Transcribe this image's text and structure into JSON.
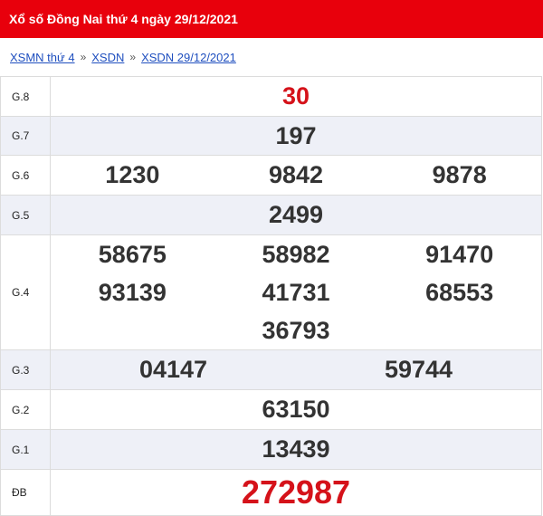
{
  "header": {
    "title": "Xổ số Đồng Nai thứ 4 ngày 29/12/2021"
  },
  "breadcrumb": {
    "items": [
      "XSMN thứ 4",
      "XSDN",
      "XSDN 29/12/2021"
    ],
    "separator": "»"
  },
  "results": {
    "g8": {
      "label": "G.8",
      "numbers": [
        "30"
      ]
    },
    "g7": {
      "label": "G.7",
      "numbers": [
        "197"
      ]
    },
    "g6": {
      "label": "G.6",
      "numbers": [
        "1230",
        "9842",
        "9878"
      ]
    },
    "g5": {
      "label": "G.5",
      "numbers": [
        "2499"
      ]
    },
    "g4": {
      "label": "G.4",
      "numbers": [
        "58675",
        "58982",
        "91470",
        "93139",
        "41731",
        "68553",
        "36793"
      ]
    },
    "g3": {
      "label": "G.3",
      "numbers": [
        "04147",
        "59744"
      ]
    },
    "g2": {
      "label": "G.2",
      "numbers": [
        "63150"
      ]
    },
    "g1": {
      "label": "G.1",
      "numbers": [
        "13439"
      ]
    },
    "db": {
      "label": "ĐB",
      "numbers": [
        "272987"
      ]
    }
  },
  "colors": {
    "header_bg": "#e8000c",
    "accent_red": "#d5121a",
    "link": "#1f4fbf",
    "row_alt": "#eef0f7"
  }
}
